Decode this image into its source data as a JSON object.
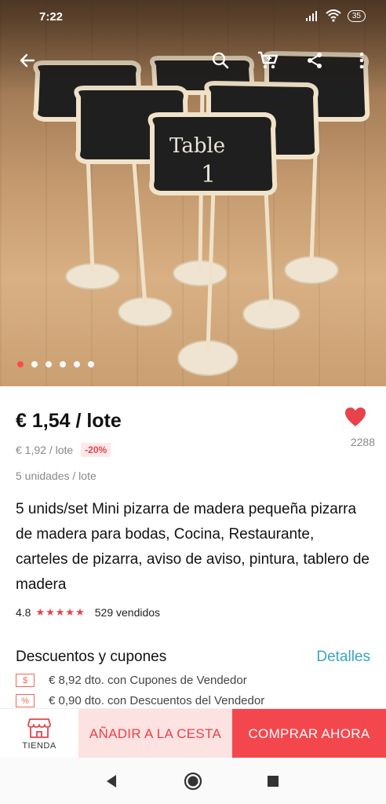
{
  "status": {
    "time": "7:22",
    "battery": "35"
  },
  "gallery": {
    "slides": 6,
    "active_index": 0,
    "board_text_line1": "Table",
    "board_text_line2": "1"
  },
  "toolbar": {
    "back_icon": "arrow-left-icon",
    "search_icon": "search-icon",
    "cart_icon": "cart-icon",
    "share_icon": "share-icon",
    "more_icon": "more-vertical-icon"
  },
  "product": {
    "price": "€ 1,54 / lote",
    "old_price": "€ 1,92 / lote",
    "discount": "-20%",
    "units": "5 unidades / lote",
    "title": "5 unids/set Mini pizarra de madera pequeña pizarra de madera para bodas, Cocina, Restaurante, carteles de pizarra, aviso de aviso, pintura, tablero de madera",
    "rating": "4.8",
    "stars": "★★★★★",
    "sold": "529 vendidos",
    "wishlist_count": "2288"
  },
  "coupons": {
    "title": "Descuentos y cupones",
    "details_label": "Detalles",
    "items": [
      {
        "icon": "$",
        "text": "€ 8,92 dto. con Cupones de Vendedor"
      },
      {
        "icon": "%",
        "text": "€ 0,90 dto. con Descuentos del Vendedor"
      }
    ]
  },
  "actions": {
    "store_label": "TIENDA",
    "add_to_cart": "AÑADIR A LA CESTA",
    "buy_now": "COMPRAR AHORA"
  },
  "colors": {
    "accent": "#f4474d",
    "link": "#3aa3c4",
    "cart_bg": "#fde2e2"
  }
}
